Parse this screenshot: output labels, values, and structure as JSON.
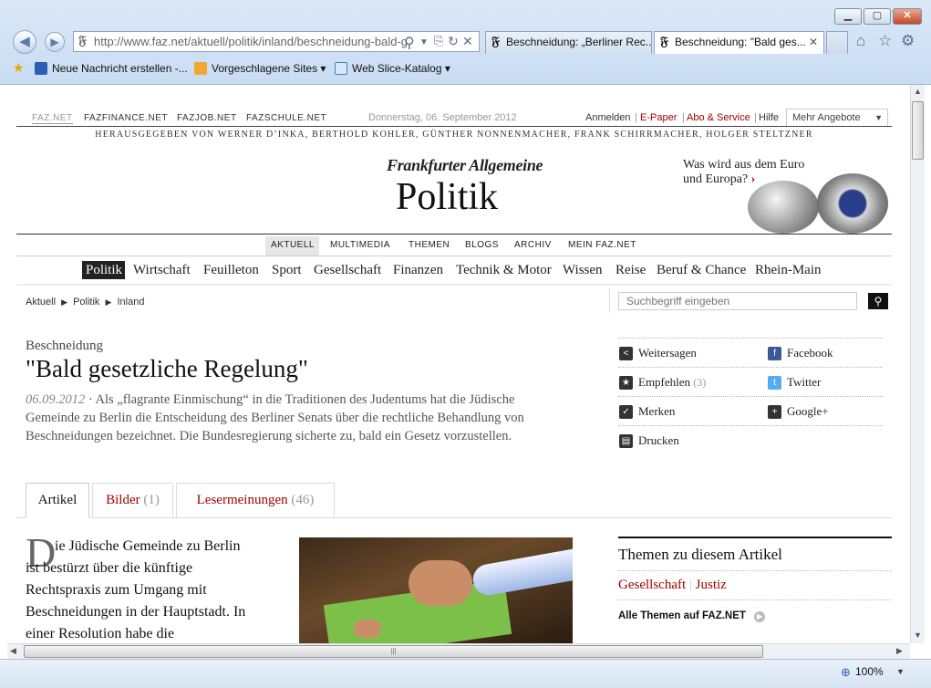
{
  "browser": {
    "url_host": "http://www.faz.net",
    "url_path": "/aktuell/politik/inland/beschneidung-bald-g",
    "tabs": [
      {
        "title": "Beschneidung: „Berliner Rec..."
      },
      {
        "title": "Beschneidung: \"Bald ges..."
      }
    ],
    "favorites": [
      {
        "label": "Neue Nachricht erstellen -..."
      },
      {
        "label": "Vorgeschlagene Sites ▾"
      },
      {
        "label": "Web Slice-Katalog ▾"
      }
    ],
    "zoom": "100%"
  },
  "site": {
    "toplinks": [
      "FAZ.NET",
      "FAZFINANCE.NET",
      "FAZJOB.NET",
      "FAZSCHULE.NET"
    ],
    "date": "Donnerstag, 06. September 2012",
    "account": {
      "login": "Anmelden",
      "epaper": "E-Paper",
      "abo": "Abo & Service",
      "help": "Hilfe",
      "more": "Mehr Angebote"
    },
    "editors": "HERAUSGEGEBEN VON WERNER D’INKA, BERTHOLD KOHLER, GÜNTHER NONNENMACHER, FRANK SCHIRRMACHER, HOLGER STELTZNER",
    "logo": "Frankfurter Allgemeine",
    "section_title": "Politik",
    "promo": {
      "line1": "Was wird aus dem Euro",
      "line2": "und Europa?",
      "arrow": "›"
    },
    "mainnav": [
      "AKTUELL",
      "MULTIMEDIA",
      "THEMEN",
      "BLOGS",
      "ARCHIV",
      "MEIN FAZ.NET"
    ],
    "sections": [
      "Politik",
      "Wirtschaft",
      "Feuilleton",
      "Sport",
      "Gesellschaft",
      "Finanzen",
      "Technik & Motor",
      "Wissen",
      "Reise",
      "Beruf & Chance",
      "Rhein-Main"
    ],
    "breadcrumb": [
      "Aktuell",
      "Politik",
      "Inland"
    ],
    "search_placeholder": "Suchbegriff eingeben"
  },
  "article": {
    "kicker": "Beschneidung",
    "headline": "\"Bald gesetzliche Regelung\"",
    "date": "06.09.2012",
    "teaser": "Als „flagrante Einmischung“ in die Traditionen des Judentums hat die Jüdische Gemeinde zu Berlin die Entscheidung des Berliner Senats über die rechtliche Behandlung von Beschneidungen bezeichnet. Die Bundesregierung sicherte zu, bald ein Gesetz vorzustellen.",
    "tabs": [
      {
        "label": "Artikel",
        "count": ""
      },
      {
        "label": "Bilder",
        "count": "(1)"
      },
      {
        "label": "Lesermeinungen",
        "count": "(46)"
      }
    ],
    "dropcap": "D",
    "body_lines": [
      "ie Jüdische Gemeinde zu Berlin",
      "ist bestürzt über die künftige",
      "Rechtspraxis zum Umgang mit",
      "Beschneidungen in der Hauptstadt. In",
      "einer Resolution habe die"
    ]
  },
  "share": [
    {
      "label": "Weitersagen",
      "count": ""
    },
    {
      "label": "Facebook",
      "count": ""
    },
    {
      "label": "Empfehlen",
      "count": "(3)"
    },
    {
      "label": "Twitter",
      "count": ""
    },
    {
      "label": "Merken",
      "count": ""
    },
    {
      "label": "Google+",
      "count": ""
    },
    {
      "label": "Drucken",
      "count": ""
    }
  ],
  "themes": {
    "title": "Themen zu diesem Artikel",
    "items": [
      "Gesellschaft",
      "Justiz"
    ],
    "all_link": "Alle Themen auf FAZ.NET"
  },
  "colors": {
    "accent": "#a00000",
    "active_section_bg": "#222222"
  }
}
